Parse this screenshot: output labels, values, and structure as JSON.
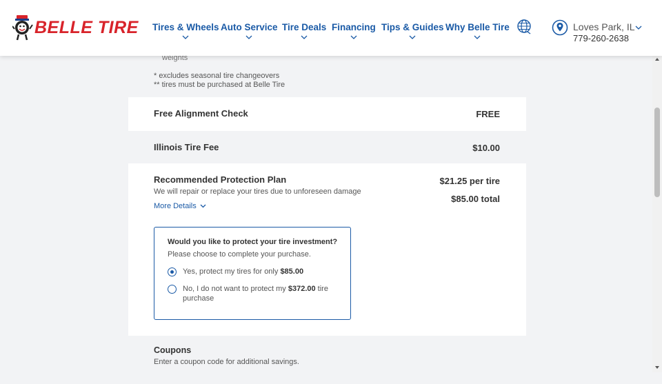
{
  "header": {
    "logo_text": "BELLE TIRE",
    "nav": [
      {
        "label": "Tires & Wheels"
      },
      {
        "label": "Auto Service"
      },
      {
        "label": "Tire Deals"
      },
      {
        "label": "Financing"
      },
      {
        "label": "Tips & Guides"
      },
      {
        "label": "Why Belle Tire"
      }
    ],
    "location": {
      "city": "Loves Park, IL",
      "phone": "779-260-2638"
    }
  },
  "content": {
    "partial_text": "weights",
    "footnotes": [
      "* excludes seasonal tire changeovers",
      "** tires must be purchased at Belle Tire"
    ],
    "rows": [
      {
        "label": "Free Alignment Check",
        "value": "FREE"
      },
      {
        "label": "Illinois Tire Fee",
        "value": "$10.00"
      }
    ],
    "protection": {
      "title": "Recommended Protection Plan",
      "description": "We will repair or replace your tires due to unforeseen damage",
      "more_details": "More Details",
      "per_tire": "$21.25 per tire",
      "total": "$85.00 total",
      "question": "Would you like to protect your tire investment?",
      "instruction": "Please choose to complete your purchase.",
      "option_yes_text": "Yes, protect my tires for only ",
      "option_yes_amount": "$85.00",
      "option_no_text": "No, I do not want to protect my ",
      "option_no_amount": "$372.00",
      "option_no_suffix": " tire purchase",
      "selected": "yes"
    },
    "coupons": {
      "title": "Coupons",
      "description": "Enter a coupon code for additional savings."
    }
  },
  "colors": {
    "brand_red": "#d8232a",
    "link_blue": "#1a5aa6",
    "section_gray": "#f2f3f5"
  }
}
